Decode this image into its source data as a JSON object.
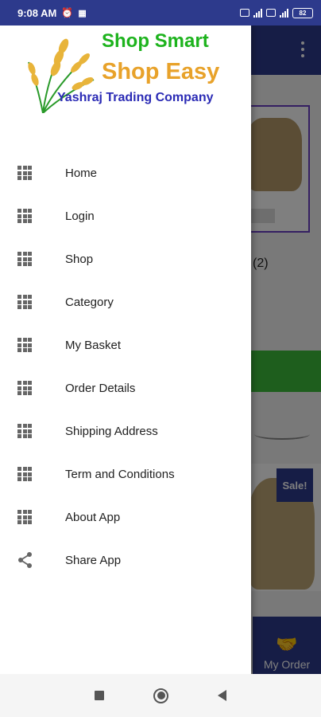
{
  "status_bar": {
    "time": "9:08 AM",
    "battery": "82"
  },
  "background": {
    "review_count": "(2)",
    "sale_badge": "Sale!",
    "my_order_label": "My Order"
  },
  "drawer": {
    "logo": {
      "line1": "Shop Smart",
      "line2": "Shop Easy",
      "line3": "Yashraj Trading Company"
    },
    "items": [
      {
        "label": "Home",
        "icon": "grid-icon"
      },
      {
        "label": "Login",
        "icon": "grid-icon"
      },
      {
        "label": "Shop",
        "icon": "grid-icon"
      },
      {
        "label": "Category",
        "icon": "grid-icon"
      },
      {
        "label": "My Basket",
        "icon": "grid-icon"
      },
      {
        "label": "Order Details",
        "icon": "grid-icon"
      },
      {
        "label": "Shipping Address",
        "icon": "grid-icon"
      },
      {
        "label": "Term and Conditions",
        "icon": "grid-icon"
      },
      {
        "label": "About App",
        "icon": "grid-icon"
      },
      {
        "label": "Share App",
        "icon": "share-icon"
      }
    ]
  },
  "colors": {
    "primary": "#2d3a8c",
    "logo_green": "#1db31d",
    "logo_orange": "#e8a22a",
    "logo_blue": "#2b2bb5"
  }
}
